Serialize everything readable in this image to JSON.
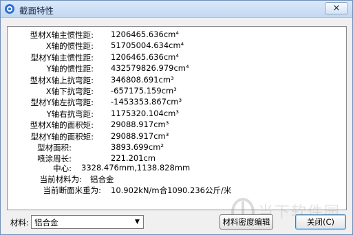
{
  "window": {
    "title": "截面特性"
  },
  "properties": [
    {
      "label": "型材X轴主惯性距:",
      "value": "1206465.636cm⁴"
    },
    {
      "label": "X轴的惯性距:",
      "value": "51705004.634cm⁴"
    },
    {
      "label": "型材Y轴主惯性距:",
      "value": "1206465.636cm⁴"
    },
    {
      "label": "Y轴的惯性距:",
      "value": "432579826.979cm⁴"
    },
    {
      "label": "型材X轴上抗弯距:",
      "value": "346808.691cm³"
    },
    {
      "label": "X轴下抗弯距:",
      "value": "-657175.159cm³"
    },
    {
      "label": "型材Y轴左抗弯距:",
      "value": "-1453353.867cm³"
    },
    {
      "label": "Y轴右抗弯距:",
      "value": "1175320.104cm³"
    },
    {
      "label": "型材X轴的面积矩:",
      "value": "29088.917cm³"
    },
    {
      "label": "型材Y轴的面积矩:",
      "value": "29088.917cm³"
    },
    {
      "label": "型材面积:",
      "value": "3893.699cm²"
    },
    {
      "label": "喷涂周长:",
      "value": "221.201cm"
    }
  ],
  "center": {
    "label": "中心:",
    "value": "3328.476mm,1138.828mm"
  },
  "current_material": {
    "label": "当前材料为:",
    "value": "铝合金"
  },
  "unit_weight": {
    "label": "当前断面米重为:",
    "value": "10.902kN/m合1090.236公斤/米"
  },
  "material_select": {
    "label": "材料:",
    "value": "铝合金"
  },
  "buttons": {
    "density_edit": "材料密度编辑",
    "close": "关闭(C)"
  },
  "titlebar": {
    "close_glyph": "✕"
  },
  "watermark": {
    "text": "当下软件园"
  },
  "colors": {
    "title_bg": "#c9dcf2",
    "dialog_bg": "#f0f0f0",
    "accent": "#3c7fb1"
  }
}
